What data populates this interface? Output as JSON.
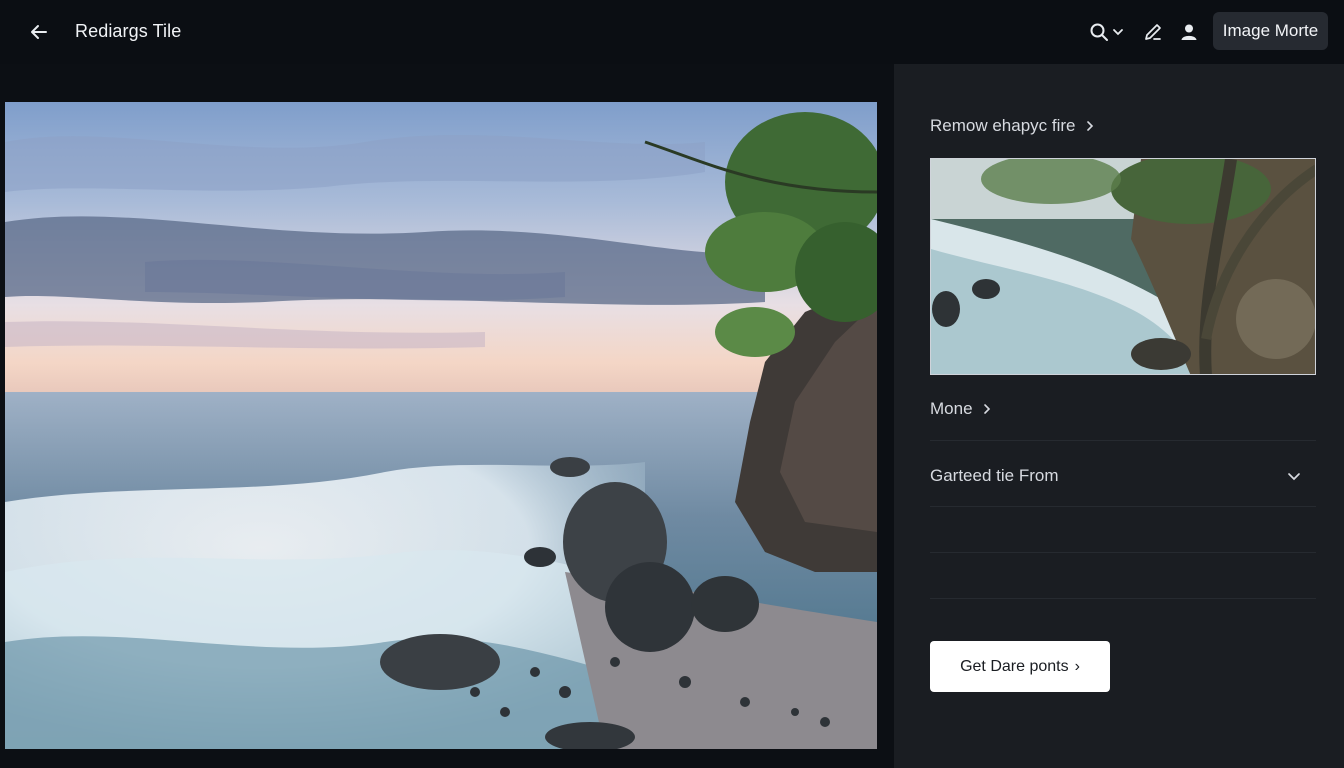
{
  "header": {
    "title": "Rediargs Tile",
    "primary_button": "Image Morte",
    "icons": [
      "back-arrow-icon",
      "search-icon",
      "chevron-down-icon",
      "edit-pen-icon",
      "user-icon"
    ]
  },
  "panel": {
    "link_top": "Remow ehapyc fire",
    "link_more": "Mone",
    "dropdown_label": "Garteed tie From",
    "cta_label": "Get Dare ponts",
    "cta_arrow": "›"
  },
  "colors": {
    "background": "#0c0f14",
    "panel": "#1a1d22",
    "button_dark": "#262a31",
    "cta": "#ffffff"
  }
}
